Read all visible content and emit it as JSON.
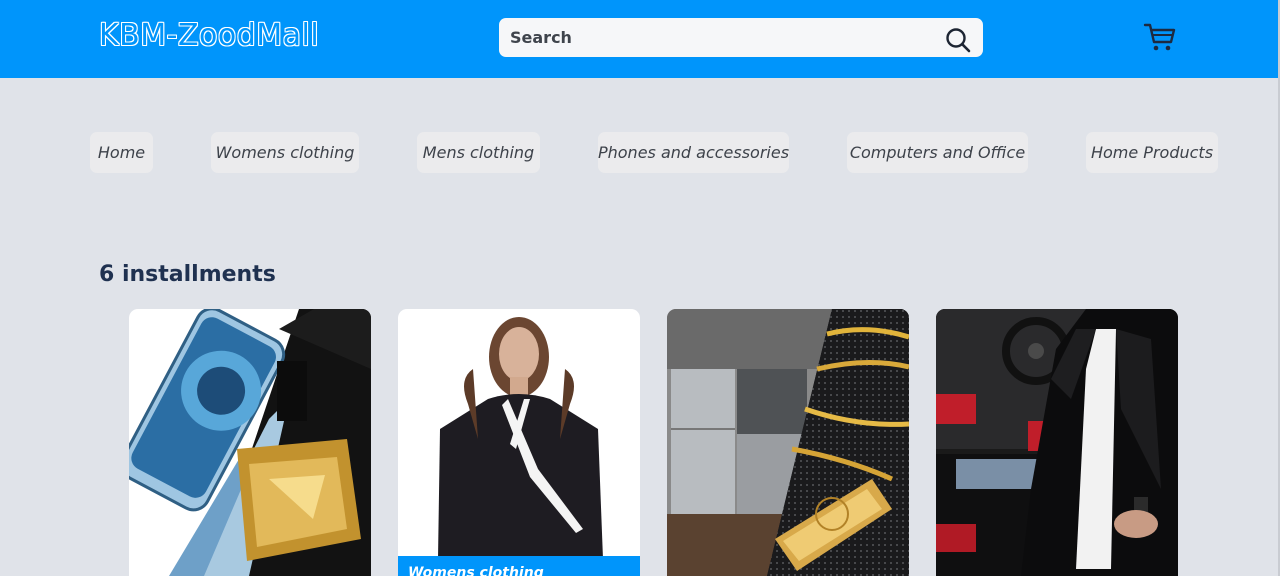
{
  "header": {
    "logo": "KBM-ZoodMall",
    "search_placeholder": "Search",
    "search_icon": "search-icon",
    "cart_icon": "cart-icon"
  },
  "nav": {
    "items": [
      {
        "label": "Home"
      },
      {
        "label": "Womens clothing"
      },
      {
        "label": "Mens clothing"
      },
      {
        "label": "Phones and accessories"
      },
      {
        "label": "Computers and Office"
      },
      {
        "label": "Home Products"
      }
    ]
  },
  "section": {
    "title": "6 installments"
  },
  "cards": [
    {
      "caption": ""
    },
    {
      "caption": "Womens clothing"
    },
    {
      "caption": ""
    },
    {
      "caption": ""
    }
  ],
  "colors": {
    "brand": "#0095fb",
    "background": "#e0e3e9",
    "nav_pill": "#ebebed",
    "title": "#1f3150"
  }
}
